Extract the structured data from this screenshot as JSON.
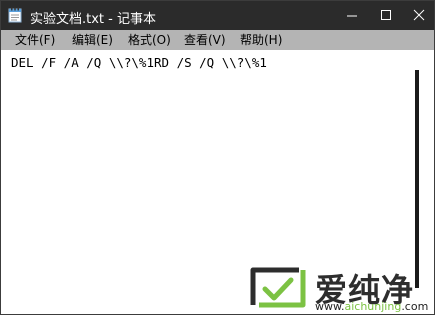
{
  "window": {
    "title": "实验文档.txt - 记事本"
  },
  "menu": {
    "items": [
      {
        "label": "文件(F)"
      },
      {
        "label": "编辑(E)"
      },
      {
        "label": "格式(O)"
      },
      {
        "label": "查看(V)"
      },
      {
        "label": "帮助(H)"
      }
    ]
  },
  "editor": {
    "content": "DEL /F /A /Q \\\\?\\%1RD /S /Q \\\\?\\%1"
  },
  "watermark": {
    "brand": "爱纯净",
    "url_prefix": "www.",
    "url_main": "aichunjing",
    "url_suffix": ".com"
  },
  "colors": {
    "titlebar": "#2b2b2b",
    "menubar": "#b4b4b4",
    "logo_green": "#7cc243"
  },
  "icons": {
    "app": "notepad-icon",
    "minimize": "minimize-icon",
    "maximize": "maximize-icon",
    "close": "close-icon"
  }
}
